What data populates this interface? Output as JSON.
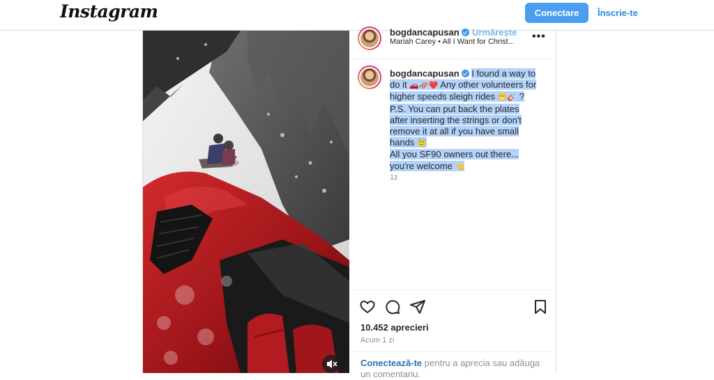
{
  "nav": {
    "logo": "Instagram",
    "login_button": "Conectare",
    "signup_link": "Înscrie-te"
  },
  "post": {
    "username": "bogdancapusan",
    "follow_label": "Urmărește",
    "audio": "Mariah Carey • All I Want for Christ...",
    "caption": {
      "line1": "I found a way to do it",
      "emoji1": "🚗🛷❤️",
      "line2": "Any other volunteers for higher speeds sleigh rides",
      "emoji2": "😁🎸",
      "line3": "? P.S. You can put back the plates after inserting the strings or don't remove it at all if you have small hands",
      "emoji3": "😇",
      "line4": "All you SF90 owners out there... you're welcome",
      "emoji4": "👈"
    },
    "caption_time": "1z",
    "likes": "10.452 aprecieri",
    "time_ago": "Acum 1 zi",
    "login_prompt": {
      "link": "Conectează-te",
      "rest": "pentru a aprecia sau adăuga un comentariu."
    }
  },
  "icons": {
    "like": "heart-icon",
    "comment": "comment-icon",
    "share": "paper-plane-icon",
    "save": "bookmark-icon",
    "more": "more-options-icon",
    "mute": "speaker-muted-icon",
    "verified": "verified-badge-icon"
  },
  "colors": {
    "primary_button": "#4a9ef0",
    "link": "#2b86e6",
    "selection_highlight": "#b3d3fb",
    "verified_badge": "#3897f0"
  }
}
